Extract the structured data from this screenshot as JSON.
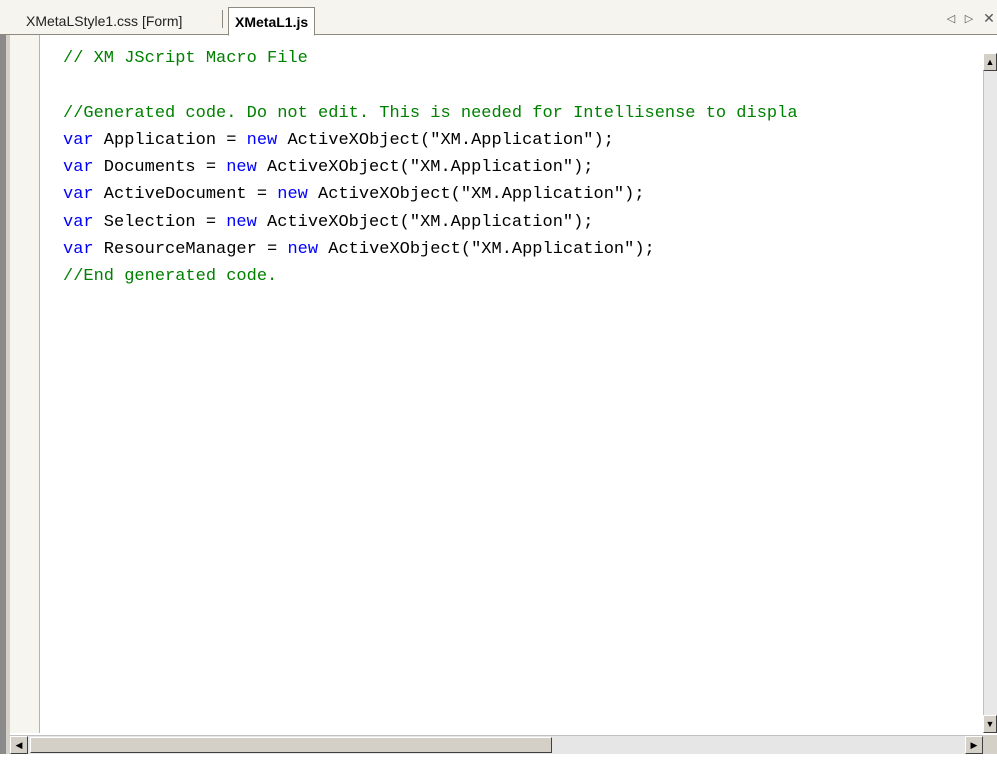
{
  "tabs": [
    {
      "label": "XMetaLStyle1.css [Form]",
      "active": false
    },
    {
      "label": "XMetaL1.js",
      "active": true
    }
  ],
  "tab_controls": {
    "scroll_left_icon": "◁",
    "scroll_right_icon": "▷",
    "close_icon": "✕"
  },
  "editor": {
    "lines": [
      [
        {
          "t": "// XM JScript Macro File",
          "c": "cm"
        }
      ],
      [],
      [
        {
          "t": "//Generated code. Do not edit. This is needed for Intellisense to displa",
          "c": "cm"
        }
      ],
      [
        {
          "t": "var",
          "c": "kw"
        },
        {
          "t": " Application = "
        },
        {
          "t": "new",
          "c": "kw"
        },
        {
          "t": " ActiveXObject(\"XM.Application\");"
        }
      ],
      [
        {
          "t": "var",
          "c": "kw"
        },
        {
          "t": " Documents = "
        },
        {
          "t": "new",
          "c": "kw"
        },
        {
          "t": " ActiveXObject(\"XM.Application\");"
        }
      ],
      [
        {
          "t": "var",
          "c": "kw"
        },
        {
          "t": " ActiveDocument = "
        },
        {
          "t": "new",
          "c": "kw"
        },
        {
          "t": " ActiveXObject(\"XM.Application\");"
        }
      ],
      [
        {
          "t": "var",
          "c": "kw"
        },
        {
          "t": " Selection = "
        },
        {
          "t": "new",
          "c": "kw"
        },
        {
          "t": " ActiveXObject(\"XM.Application\");"
        }
      ],
      [
        {
          "t": "var",
          "c": "kw"
        },
        {
          "t": " ResourceManager = "
        },
        {
          "t": "new",
          "c": "kw"
        },
        {
          "t": " ActiveXObject(\"XM.Application\");"
        }
      ],
      [
        {
          "t": "//End generated code.",
          "c": "cm"
        }
      ]
    ]
  },
  "colors": {
    "keyword": "#0000ff",
    "comment": "#008000",
    "text": "#000000"
  },
  "scrollbars": {
    "up_icon": "▲",
    "down_icon": "▼",
    "left_icon": "◀",
    "right_icon": "▶"
  }
}
